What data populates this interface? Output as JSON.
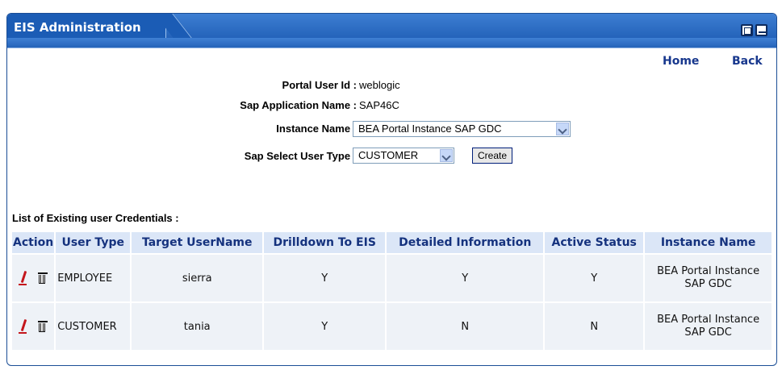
{
  "header": {
    "title": "EIS Administration",
    "maximize_icon": "maximize-icon",
    "minimize_icon": "minimize-icon"
  },
  "nav": {
    "home": "Home",
    "back": "Back"
  },
  "form": {
    "portal_user_label": "Portal User Id :",
    "portal_user_value": "weblogic",
    "sap_app_label": "Sap Application Name :",
    "sap_app_value": "SAP46C",
    "instance_label": "Instance Name :",
    "instance_selected": "BEA Portal Instance SAP GDC",
    "user_type_label": "Sap Select User Type :",
    "user_type_selected": "CUSTOMER",
    "create_button": "Create"
  },
  "list": {
    "title": "List of Existing user Credentials :",
    "columns": [
      "Action",
      "User Type",
      "Target UserName",
      "Drilldown To EIS",
      "Detailed Information",
      "Active Status",
      "Instance Name"
    ],
    "rows": [
      {
        "user_type": "EMPLOYEE",
        "target": "sierra",
        "drilldown": "Y",
        "detailed": "Y",
        "active": "Y",
        "instance": "BEA Portal Instance SAP GDC"
      },
      {
        "user_type": "CUSTOMER",
        "target": "tania",
        "drilldown": "Y",
        "detailed": "N",
        "active": "N",
        "instance": "BEA Portal Instance SAP GDC"
      }
    ]
  },
  "colors": {
    "titlebar": "#1b5cb5",
    "link": "#17378d",
    "header_bg": "#dbe6f7",
    "row_bg": "#eef2f7"
  }
}
